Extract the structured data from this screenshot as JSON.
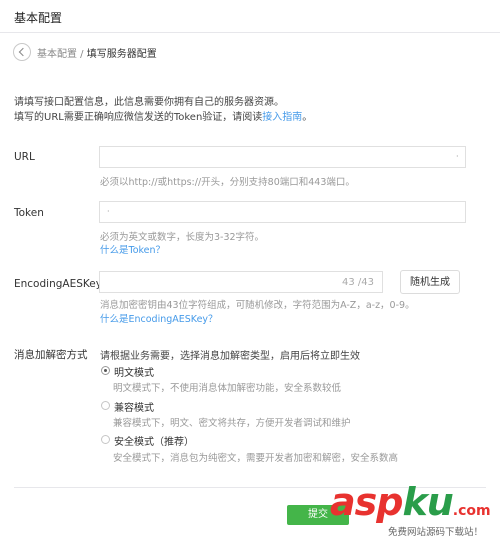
{
  "header": {
    "title": "基本配置"
  },
  "breadcrumb": {
    "parent": "基本配置",
    "separator": " / ",
    "current": "填写服务器配置"
  },
  "intro": {
    "line1": "请填写接口配置信息，此信息需要你拥有自己的服务器资源。",
    "line2_text": "填写的URL需要正确响应微信发送的Token验证，请阅读",
    "line2_link": "接入指南",
    "line2_end": "。"
  },
  "url": {
    "label": "URL",
    "value": "",
    "tip": "必须以http://或https://开头，分别支持80端口和443端口。"
  },
  "token": {
    "label": "Token",
    "value": "",
    "tip": "必须为英文或数字，长度为3-32字符。",
    "link": "什么是Token？"
  },
  "aeskey": {
    "label": "EncodingAESKey",
    "value": "",
    "counter": "43 /43",
    "random_button": "随机生成",
    "tip": "消息加密密钥由43位字符组成，可随机修改，字符范围为A-Z，a-z，0-9。",
    "link": "什么是EncodingAESKey？"
  },
  "encryption": {
    "label": "消息加解密方式",
    "hint": "请根据业务需要，选择消息加解密类型，启用后将立即生效",
    "selected": "明文模式",
    "options": [
      {
        "label": "明文模式",
        "desc": "明文模式下，不使用消息体加解密功能，安全系数较低"
      },
      {
        "label": "兼容模式",
        "desc": "兼容模式下，明文、密文将共存，方便开发者调试和维护"
      },
      {
        "label": "安全模式（推荐）",
        "desc": "安全模式下，消息包为纯密文，需要开发者加密和解密，安全系数高"
      }
    ]
  },
  "footer": {
    "submit": "提交"
  },
  "watermark": {
    "brand_part1": "asp",
    "brand_part2": "ku",
    "brand_tld": ".com",
    "sub": "免费网站源码下载站！"
  },
  "colors": {
    "link": "#459ae9",
    "submit_bg": "#44b549",
    "watermark_red": "#e8322f",
    "watermark_green": "#2a9d4a"
  }
}
